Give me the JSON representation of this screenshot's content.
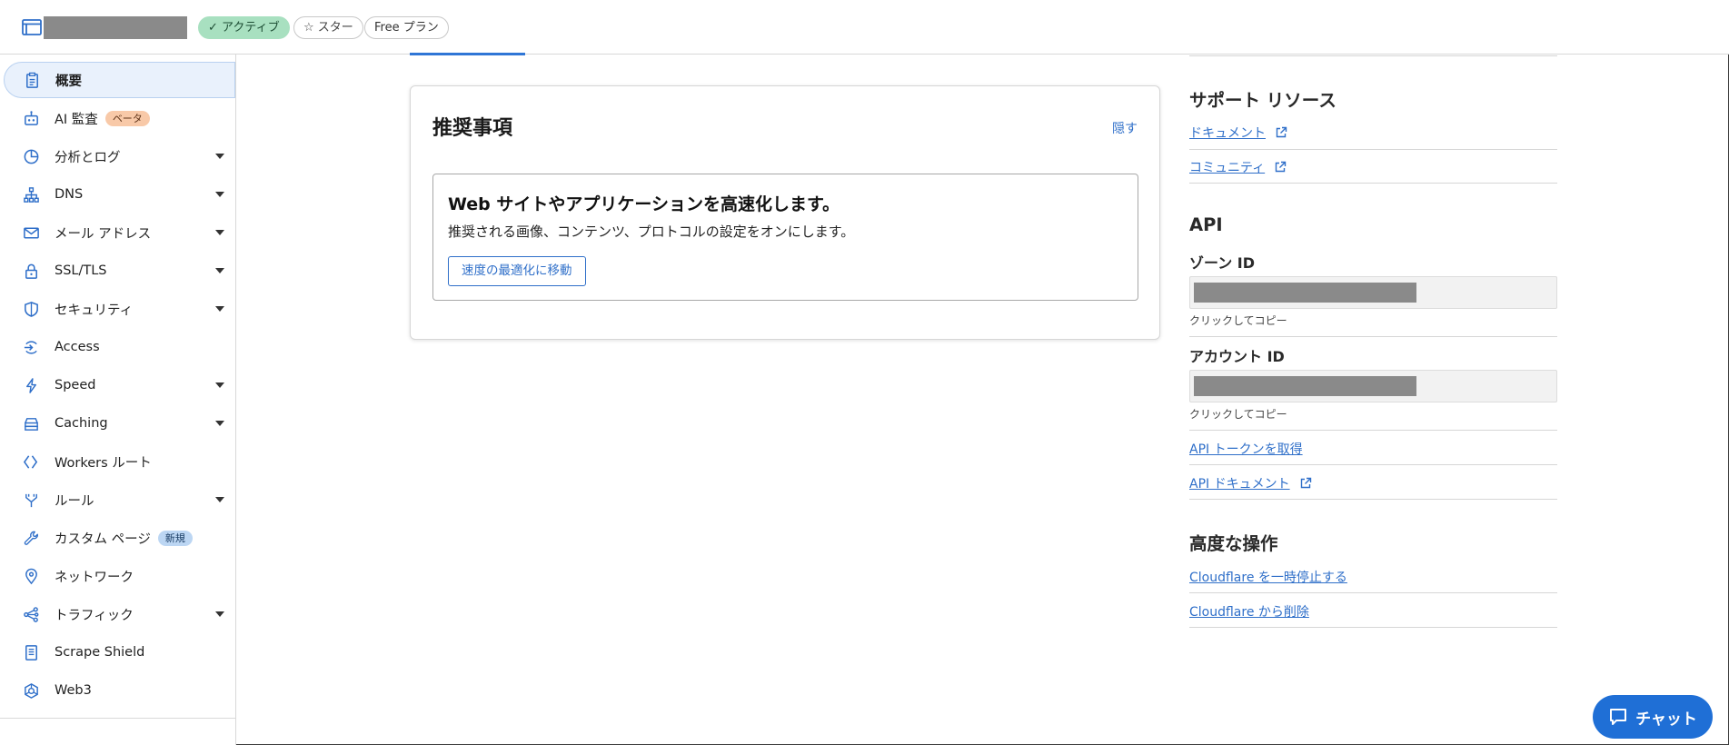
{
  "header": {
    "status_badge": "✓ アクティブ",
    "star_badge": "☆ スター",
    "plan_badge": "Free プラン"
  },
  "sidebar": {
    "items": [
      {
        "label": "概要",
        "icon": "clipboard-icon",
        "active": true
      },
      {
        "label": "AI 監査",
        "icon": "robot-icon",
        "pill": "ベータ"
      },
      {
        "label": "分析とログ",
        "icon": "pie-chart-icon",
        "expandable": true
      },
      {
        "label": "DNS",
        "icon": "network-tree-icon",
        "expandable": true
      },
      {
        "label": "メール アドレス",
        "icon": "mail-icon",
        "expandable": true
      },
      {
        "label": "SSL/TLS",
        "icon": "lock-icon",
        "expandable": true
      },
      {
        "label": "セキュリティ",
        "icon": "shield-icon",
        "expandable": true
      },
      {
        "label": "Access",
        "icon": "access-icon"
      },
      {
        "label": "Speed",
        "icon": "lightning-icon",
        "expandable": true
      },
      {
        "label": "Caching",
        "icon": "server-stack-icon",
        "expandable": true
      },
      {
        "label": "Workers ルート",
        "icon": "workers-icon"
      },
      {
        "label": "ルール",
        "icon": "rules-icon",
        "expandable": true
      },
      {
        "label": "カスタム ページ",
        "icon": "wrench-icon",
        "pill": "新規"
      },
      {
        "label": "ネットワーク",
        "icon": "location-pin-icon"
      },
      {
        "label": "トラフィック",
        "icon": "traffic-icon",
        "expandable": true
      },
      {
        "label": "Scrape Shield",
        "icon": "document-icon"
      },
      {
        "label": "Web3",
        "icon": "web3-icon"
      }
    ]
  },
  "recommendations": {
    "title": "推奨事項",
    "hide_label": "隠す",
    "item": {
      "title": "Web サイトやアプリケーションを高速化します。",
      "description": "推奨される画像、コンテンツ、プロトコルの設定をオンにします。",
      "button_label": "速度の最適化に移動"
    }
  },
  "support": {
    "title": "サポート リソース",
    "links": [
      "ドキュメント",
      "コミュニティ"
    ]
  },
  "api": {
    "title": "API",
    "zone_id_label": "ゾーン ID",
    "account_id_label": "アカウント ID",
    "copy_hint": "クリックしてコピー",
    "token_link": "API トークンを取得",
    "docs_link": "API ドキュメント"
  },
  "advanced": {
    "title": "高度な操作",
    "pause_link": "Cloudflare を一時停止する",
    "remove_link": "Cloudflare から削除"
  },
  "chat": {
    "label": "チャット"
  },
  "colors": {
    "accent": "#2f6fc9",
    "chat": "#1f6fd6",
    "active_badge": "#a8e0c0"
  }
}
